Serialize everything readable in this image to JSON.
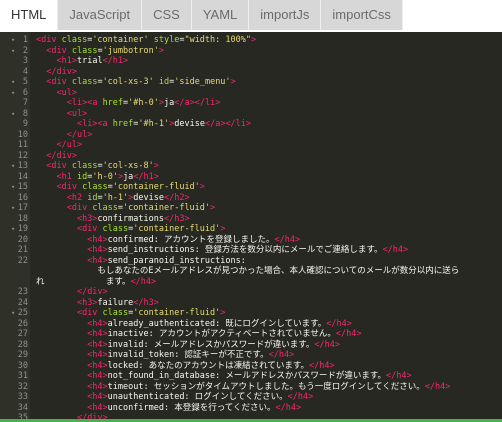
{
  "tabs": [
    {
      "label": "HTML",
      "active": true
    },
    {
      "label": "JavaScript",
      "active": false
    },
    {
      "label": "CSS",
      "active": false
    },
    {
      "label": "YAML",
      "active": false
    },
    {
      "label": "importJs",
      "active": false
    },
    {
      "label": "importCss",
      "active": false
    }
  ],
  "editor": {
    "lines": [
      {
        "n": "1",
        "segs": [
          [
            "tag",
            "<div "
          ],
          [
            "attr",
            "class"
          ],
          [
            "txt",
            "="
          ],
          [
            "str",
            "'container'"
          ],
          [
            "txt",
            " "
          ],
          [
            "attr",
            "style"
          ],
          [
            "txt",
            "="
          ],
          [
            "str",
            "\"width: 100%\""
          ],
          [
            "tag",
            ">"
          ]
        ]
      },
      {
        "n": "2",
        "segs": [
          [
            "txt",
            "  "
          ],
          [
            "tag",
            "<div "
          ],
          [
            "attr",
            "class"
          ],
          [
            "txt",
            "="
          ],
          [
            "str",
            "'jumbotron'"
          ],
          [
            "tag",
            ">"
          ]
        ]
      },
      {
        "n": "3",
        "segs": [
          [
            "txt",
            "    "
          ],
          [
            "tag",
            "<h1>"
          ],
          [
            "txt",
            "trial"
          ],
          [
            "tag",
            "</h1>"
          ]
        ]
      },
      {
        "n": "4",
        "segs": [
          [
            "txt",
            "  "
          ],
          [
            "tag",
            "</div>"
          ]
        ]
      },
      {
        "n": "5",
        "segs": [
          [
            "txt",
            "  "
          ],
          [
            "tag",
            "<div "
          ],
          [
            "attr",
            "class"
          ],
          [
            "txt",
            "="
          ],
          [
            "str",
            "'col-xs-3'"
          ],
          [
            "txt",
            " "
          ],
          [
            "attr",
            "id"
          ],
          [
            "txt",
            "="
          ],
          [
            "str",
            "'side_menu'"
          ],
          [
            "tag",
            ">"
          ]
        ]
      },
      {
        "n": "6",
        "segs": [
          [
            "txt",
            "    "
          ],
          [
            "tag",
            "<ul>"
          ]
        ]
      },
      {
        "n": "7",
        "segs": [
          [
            "txt",
            "      "
          ],
          [
            "tag",
            "<li>"
          ],
          [
            "tag",
            "<a "
          ],
          [
            "attr",
            "href"
          ],
          [
            "txt",
            "="
          ],
          [
            "str",
            "'#h-0'"
          ],
          [
            "tag",
            ">"
          ],
          [
            "txt",
            "ja"
          ],
          [
            "tag",
            "</a></li>"
          ]
        ]
      },
      {
        "n": "8",
        "segs": [
          [
            "txt",
            "      "
          ],
          [
            "tag",
            "<ul>"
          ]
        ]
      },
      {
        "n": "9",
        "segs": [
          [
            "txt",
            "        "
          ],
          [
            "tag",
            "<li>"
          ],
          [
            "tag",
            "<a "
          ],
          [
            "attr",
            "href"
          ],
          [
            "txt",
            "="
          ],
          [
            "str",
            "'#h-1'"
          ],
          [
            "tag",
            ">"
          ],
          [
            "txt",
            "devise"
          ],
          [
            "tag",
            "</a></li>"
          ]
        ]
      },
      {
        "n": "10",
        "segs": [
          [
            "txt",
            "      "
          ],
          [
            "tag",
            "</ul>"
          ]
        ]
      },
      {
        "n": "11",
        "segs": [
          [
            "txt",
            "    "
          ],
          [
            "tag",
            "</ul>"
          ]
        ]
      },
      {
        "n": "12",
        "segs": [
          [
            "txt",
            "  "
          ],
          [
            "tag",
            "</div>"
          ]
        ]
      },
      {
        "n": "13",
        "segs": [
          [
            "txt",
            "  "
          ],
          [
            "tag",
            "<div "
          ],
          [
            "attr",
            "class"
          ],
          [
            "txt",
            "="
          ],
          [
            "str",
            "'col-xs-8'"
          ],
          [
            "tag",
            ">"
          ]
        ]
      },
      {
        "n": "14",
        "segs": [
          [
            "txt",
            "    "
          ],
          [
            "tag",
            "<h1 "
          ],
          [
            "attr",
            "id"
          ],
          [
            "txt",
            "="
          ],
          [
            "str",
            "'h-0'"
          ],
          [
            "tag",
            ">"
          ],
          [
            "txt",
            "ja"
          ],
          [
            "tag",
            "</h1>"
          ]
        ]
      },
      {
        "n": "15",
        "segs": [
          [
            "txt",
            "    "
          ],
          [
            "tag",
            "<div "
          ],
          [
            "attr",
            "class"
          ],
          [
            "txt",
            "="
          ],
          [
            "str",
            "'container-fluid'"
          ],
          [
            "tag",
            ">"
          ]
        ]
      },
      {
        "n": "16",
        "segs": [
          [
            "txt",
            "      "
          ],
          [
            "tag",
            "<h2 "
          ],
          [
            "attr",
            "id"
          ],
          [
            "txt",
            "="
          ],
          [
            "str",
            "'h-1'"
          ],
          [
            "tag",
            ">"
          ],
          [
            "txt",
            "devise"
          ],
          [
            "tag",
            "</h2>"
          ]
        ]
      },
      {
        "n": "17",
        "segs": [
          [
            "txt",
            "      "
          ],
          [
            "tag",
            "<div "
          ],
          [
            "attr",
            "class"
          ],
          [
            "txt",
            "="
          ],
          [
            "str",
            "'container-fluid'"
          ],
          [
            "tag",
            ">"
          ]
        ]
      },
      {
        "n": "18",
        "segs": [
          [
            "txt",
            "        "
          ],
          [
            "tag",
            "<h3>"
          ],
          [
            "txt",
            "confirmations"
          ],
          [
            "tag",
            "</h3>"
          ]
        ]
      },
      {
        "n": "19",
        "segs": [
          [
            "txt",
            "        "
          ],
          [
            "tag",
            "<div "
          ],
          [
            "attr",
            "class"
          ],
          [
            "txt",
            "="
          ],
          [
            "str",
            "'container-fluid'"
          ],
          [
            "tag",
            ">"
          ]
        ]
      },
      {
        "n": "20",
        "segs": [
          [
            "txt",
            "          "
          ],
          [
            "tag",
            "<h4>"
          ],
          [
            "txt",
            "confirmed: アカウントを登録しました。"
          ],
          [
            "tag",
            "</h4>"
          ]
        ]
      },
      {
        "n": "21",
        "segs": [
          [
            "txt",
            "          "
          ],
          [
            "tag",
            "<h4>"
          ],
          [
            "txt",
            "send_instructions: 登録方法を数分以内にメールでご連絡します。"
          ],
          [
            "tag",
            "</h4>"
          ]
        ]
      },
      {
        "n": "22",
        "segs": [
          [
            "txt",
            "          "
          ],
          [
            "tag",
            "<h4>"
          ],
          [
            "txt",
            "send_paranoid_instructions:"
          ]
        ]
      },
      {
        "n": "",
        "segs": [
          [
            "txt",
            "            もしあなたのEメールアドレスが見つかった場合、本人確認についてのメールが数分以内に送ら"
          ]
        ]
      },
      {
        "n": "",
        "segs": [
          [
            "txt",
            "れ            ます。"
          ],
          [
            "tag",
            "</h4>"
          ]
        ]
      },
      {
        "n": "23",
        "segs": [
          [
            "txt",
            "        "
          ],
          [
            "tag",
            "</div>"
          ]
        ]
      },
      {
        "n": "24",
        "segs": [
          [
            "txt",
            "        "
          ],
          [
            "tag",
            "<h3>"
          ],
          [
            "txt",
            "failure"
          ],
          [
            "tag",
            "</h3>"
          ]
        ]
      },
      {
        "n": "25",
        "segs": [
          [
            "txt",
            "        "
          ],
          [
            "tag",
            "<div "
          ],
          [
            "attr",
            "class"
          ],
          [
            "txt",
            "="
          ],
          [
            "str",
            "'container-fluid'"
          ],
          [
            "tag",
            ">"
          ]
        ]
      },
      {
        "n": "26",
        "segs": [
          [
            "txt",
            "          "
          ],
          [
            "tag",
            "<h4>"
          ],
          [
            "txt",
            "already_authenticated: 既にログインしています。"
          ],
          [
            "tag",
            "</h4>"
          ]
        ]
      },
      {
        "n": "27",
        "segs": [
          [
            "txt",
            "          "
          ],
          [
            "tag",
            "<h4>"
          ],
          [
            "txt",
            "inactive: アカウントがアクティベートされていません。"
          ],
          [
            "tag",
            "</h4>"
          ]
        ]
      },
      {
        "n": "28",
        "segs": [
          [
            "txt",
            "          "
          ],
          [
            "tag",
            "<h4>"
          ],
          [
            "txt",
            "invalid: メールアドレスかパスワードが違います。"
          ],
          [
            "tag",
            "</h4>"
          ]
        ]
      },
      {
        "n": "29",
        "segs": [
          [
            "txt",
            "          "
          ],
          [
            "tag",
            "<h4>"
          ],
          [
            "txt",
            "invalid_token: 認証キーが不正です。"
          ],
          [
            "tag",
            "</h4>"
          ]
        ]
      },
      {
        "n": "30",
        "segs": [
          [
            "txt",
            "          "
          ],
          [
            "tag",
            "<h4>"
          ],
          [
            "txt",
            "locked: あなたのアカウントは凍結されています。"
          ],
          [
            "tag",
            "</h4>"
          ]
        ]
      },
      {
        "n": "31",
        "segs": [
          [
            "txt",
            "          "
          ],
          [
            "tag",
            "<h4>"
          ],
          [
            "txt",
            "not_found_in_database: メールアドレスかパスワードが違います。"
          ],
          [
            "tag",
            "</h4>"
          ]
        ]
      },
      {
        "n": "32",
        "segs": [
          [
            "txt",
            "          "
          ],
          [
            "tag",
            "<h4>"
          ],
          [
            "txt",
            "timeout: セッションがタイムアウトしました。もう一度ログインしてください。"
          ],
          [
            "tag",
            "</h4>"
          ]
        ]
      },
      {
        "n": "33",
        "segs": [
          [
            "txt",
            "          "
          ],
          [
            "tag",
            "<h4>"
          ],
          [
            "txt",
            "unauthenticated: ログインしてください。"
          ],
          [
            "tag",
            "</h4>"
          ]
        ]
      },
      {
        "n": "34",
        "segs": [
          [
            "txt",
            "          "
          ],
          [
            "tag",
            "<h4>"
          ],
          [
            "txt",
            "unconfirmed: 本登録を行ってください。"
          ],
          [
            "tag",
            "</h4>"
          ]
        ]
      },
      {
        "n": "35",
        "segs": [
          [
            "txt",
            "        "
          ],
          [
            "tag",
            "</div>"
          ]
        ]
      }
    ]
  }
}
